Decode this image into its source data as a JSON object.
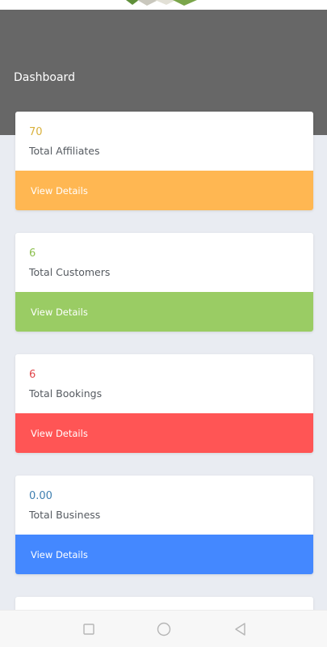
{
  "header": {
    "title": "Dashboard"
  },
  "cards": [
    {
      "value": "70",
      "label": "Total Affiliates",
      "action": "View Details",
      "value_color": "#d9b13c",
      "accent": "#ffb752"
    },
    {
      "value": "6",
      "label": "Total Customers",
      "action": "View Details",
      "value_color": "#8cbf4e",
      "accent": "#9acc64"
    },
    {
      "value": "6",
      "label": "Total Bookings",
      "action": "View Details",
      "value_color": "#e0464a",
      "accent": "#ff5555"
    },
    {
      "value": "0.00",
      "label": "Total Business",
      "action": "View Details",
      "value_color": "#3f7fb0",
      "accent": "#4488ff"
    }
  ],
  "colors": {
    "header_bg": "#676767",
    "page_bg": "#e9ecf2"
  },
  "navbar": {
    "icons": [
      "square-icon",
      "circle-icon",
      "back-triangle-icon"
    ]
  }
}
